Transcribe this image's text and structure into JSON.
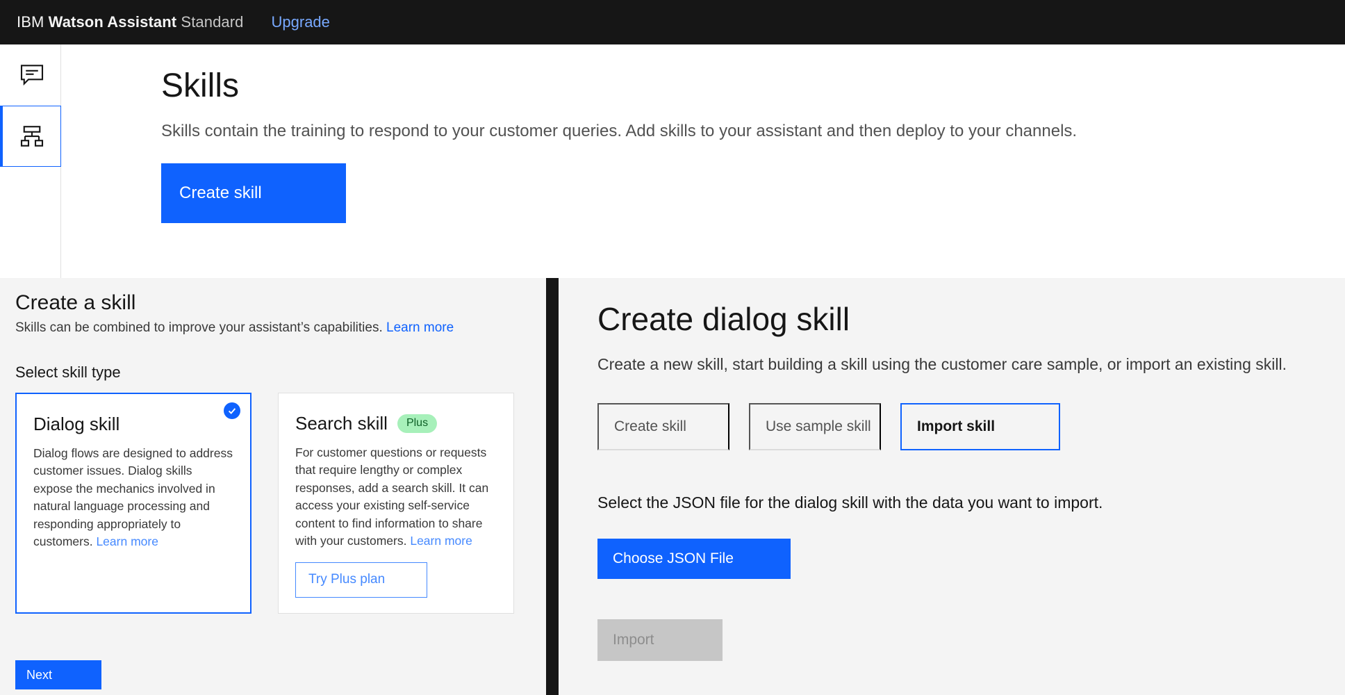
{
  "header": {
    "brand_ibm": "IBM",
    "brand_product": "Watson Assistant",
    "brand_plan": "Standard",
    "upgrade_label": "Upgrade"
  },
  "rail": {
    "items": [
      {
        "name": "assistants",
        "icon": "chat-bubble-icon",
        "active": false
      },
      {
        "name": "skills",
        "icon": "skills-hierarchy-icon",
        "active": true
      }
    ]
  },
  "page": {
    "title": "Skills",
    "subtitle": "Skills contain the training to respond to your customer queries. Add skills to your assistant and then deploy to your channels.",
    "create_skill_label": "Create skill"
  },
  "create_panel": {
    "title": "Create a skill",
    "subtitle": "Skills can be combined to improve your assistant’s capabilities.",
    "subtitle_link": "Learn more",
    "section_label": "Select skill type",
    "cards": [
      {
        "title": "Dialog skill",
        "badge": "",
        "description": "Dialog flows are designed to address customer issues. Dialog skills expose the mechanics involved in natural language processing and responding appropriately to customers.",
        "link": "Learn more",
        "selected": true,
        "button": ""
      },
      {
        "title": "Search skill",
        "badge": "Plus",
        "description": "For customer questions or requests that require lengthy or complex responses, add a search skill. It can access your existing self-service content to find information to share with your customers.",
        "link": "Learn more",
        "selected": false,
        "button": "Try Plus plan"
      }
    ],
    "next_label": "Next"
  },
  "dialog_panel": {
    "title": "Create dialog skill",
    "subtitle": "Create a new skill, start building a skill using the customer care sample, or import an existing skill.",
    "tabs": [
      {
        "label": "Create skill",
        "active": false
      },
      {
        "label": "Use sample skill",
        "active": false
      },
      {
        "label": "Import skill",
        "active": true
      }
    ],
    "instruction": "Select the JSON file for the dialog skill with the data you want to import.",
    "choose_file_label": "Choose JSON File",
    "import_label": "Import"
  },
  "colors": {
    "brand_blue": "#0f62fe",
    "link_light_blue": "#4589ff",
    "header_black": "#161616",
    "panel_gray": "#f4f4f4",
    "badge_green_bg": "#a7f0ba",
    "badge_green_text": "#0e6027",
    "disabled_gray": "#c6c6c6"
  }
}
